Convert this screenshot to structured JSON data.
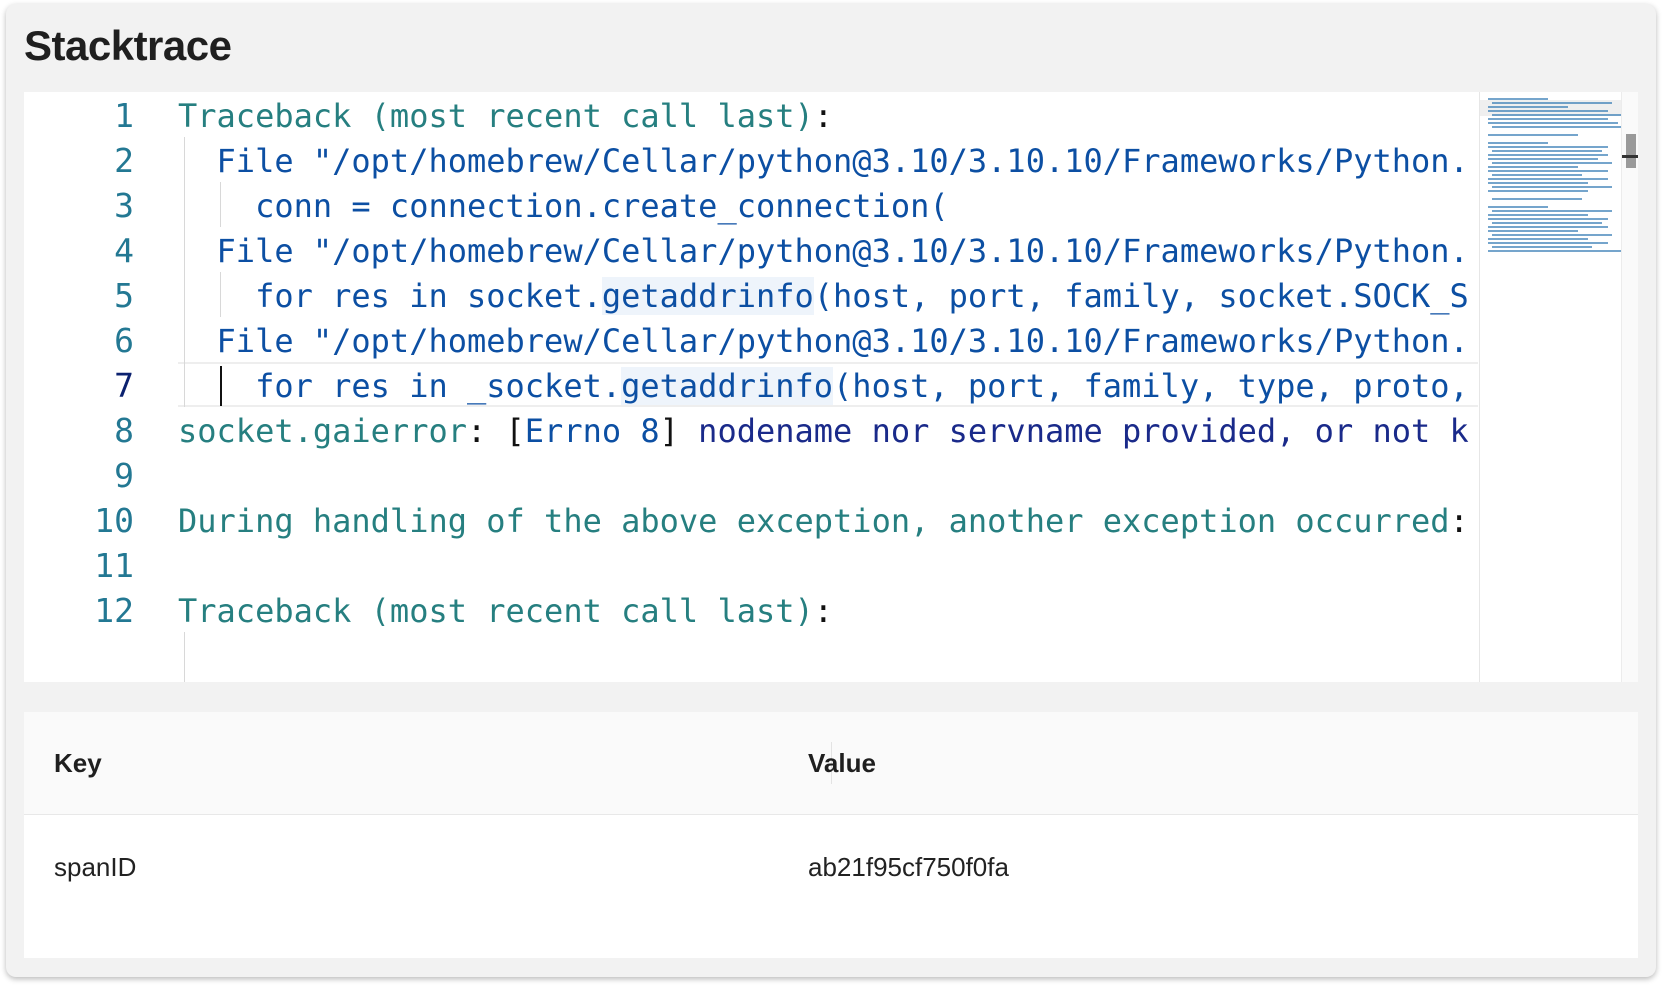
{
  "panel": {
    "title": "Stacktrace"
  },
  "editor": {
    "active_line": 7,
    "lines": [
      {
        "n": "1",
        "segs": [
          {
            "t": "Traceback (most recent call last)",
            "c": "teal"
          },
          {
            "t": ":",
            "c": "dark"
          }
        ]
      },
      {
        "n": "2",
        "segs": [
          {
            "t": "  File \"/opt/homebrew/Cellar/python@3.10/3.10.10/Frameworks/Python.",
            "c": "blue"
          }
        ]
      },
      {
        "n": "3",
        "segs": [
          {
            "t": "    conn = connection.create_connection(",
            "c": "blue"
          }
        ]
      },
      {
        "n": "4",
        "segs": [
          {
            "t": "  File \"/opt/homebrew/Cellar/python@3.10/3.10.10/Frameworks/Python.",
            "c": "blue"
          }
        ]
      },
      {
        "n": "5",
        "segs": [
          {
            "t": "    for res in socket.",
            "c": "blue"
          },
          {
            "t": "getaddrinfo",
            "c": "blue",
            "hl": true
          },
          {
            "t": "(host, port, family, socket.SOCK_S",
            "c": "blue"
          }
        ]
      },
      {
        "n": "6",
        "segs": [
          {
            "t": "  File \"/opt/homebrew/Cellar/python@3.10/3.10.10/Frameworks/Python.",
            "c": "blue"
          }
        ]
      },
      {
        "n": "7",
        "segs": [
          {
            "t": "    for res in _socket.",
            "c": "blue"
          },
          {
            "t": "getaddrinfo",
            "c": "blue",
            "hl": true
          },
          {
            "t": "(host, port, family, type, proto,",
            "c": "blue"
          }
        ]
      },
      {
        "n": "8",
        "segs": [
          {
            "t": "socket.gaierror",
            "c": "teal"
          },
          {
            "t": ": ",
            "c": "dark"
          },
          {
            "t": "[",
            "c": "dark"
          },
          {
            "t": "Errno 8",
            "c": "blue"
          },
          {
            "t": "]",
            "c": "dark"
          },
          {
            "t": " nodename nor servname provided, or not k",
            "c": "navy"
          }
        ]
      },
      {
        "n": "9",
        "segs": []
      },
      {
        "n": "10",
        "segs": [
          {
            "t": "During handling of the above exception, another exception occurred",
            "c": "teal"
          },
          {
            "t": ":",
            "c": "dark"
          }
        ]
      },
      {
        "n": "11",
        "segs": []
      },
      {
        "n": "12",
        "segs": [
          {
            "t": "Traceback (most recent call last)",
            "c": "teal"
          },
          {
            "t": ":",
            "c": "dark"
          }
        ]
      }
    ]
  },
  "table": {
    "headers": {
      "key": "Key",
      "value": "Value"
    },
    "rows": [
      {
        "key": "spanID",
        "value": "ab21f95cf750f0fa"
      }
    ]
  }
}
